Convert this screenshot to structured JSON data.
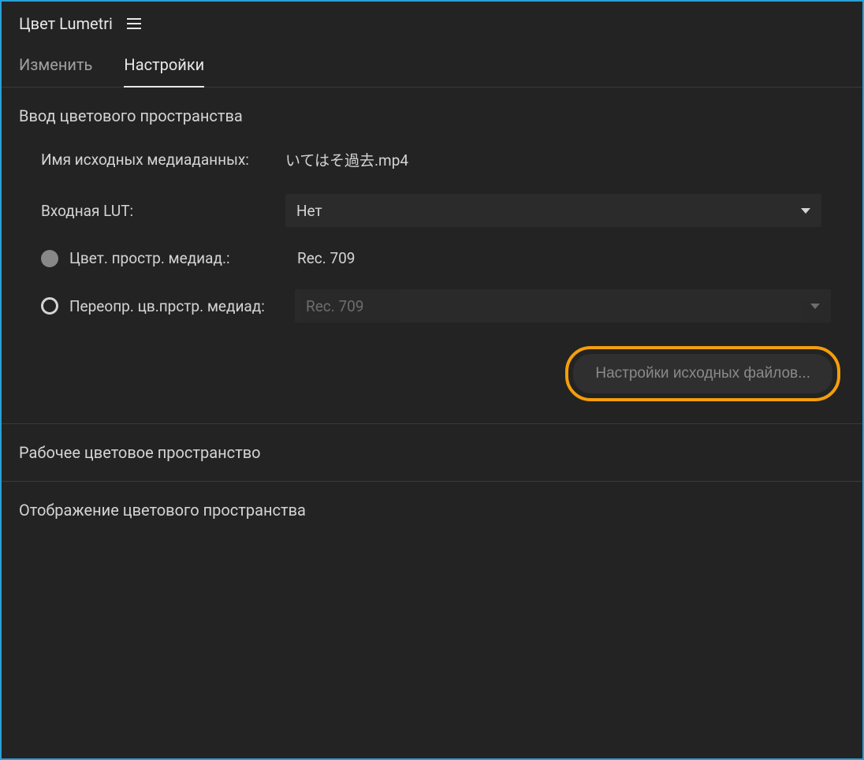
{
  "panel": {
    "title": "Цвет Lumetri"
  },
  "tabs": {
    "edit": "Изменить",
    "settings": "Настройки"
  },
  "inputColorSpace": {
    "title": "Ввод цветового пространства",
    "sourceMediaNameLabel": "Имя исходных медиаданных:",
    "sourceMediaNameValue": "いてはそ過去.mp4",
    "inputLutLabel": "Входная LUT:",
    "inputLutValue": "Нет",
    "mediaColorSpaceLabel": "Цвет. простр. медиад.:",
    "mediaColorSpaceValue": "Rec. 709",
    "overrideMediaColorSpaceLabel": "Переопр. цв.прстр. медиад:",
    "overrideMediaColorSpaceValue": "Rec. 709",
    "sourceSettingsButton": "Настройки исходных файлов..."
  },
  "workingColorSpace": {
    "title": "Рабочее цветовое пространство"
  },
  "displayColorSpace": {
    "title": "Отображение цветового пространства"
  }
}
